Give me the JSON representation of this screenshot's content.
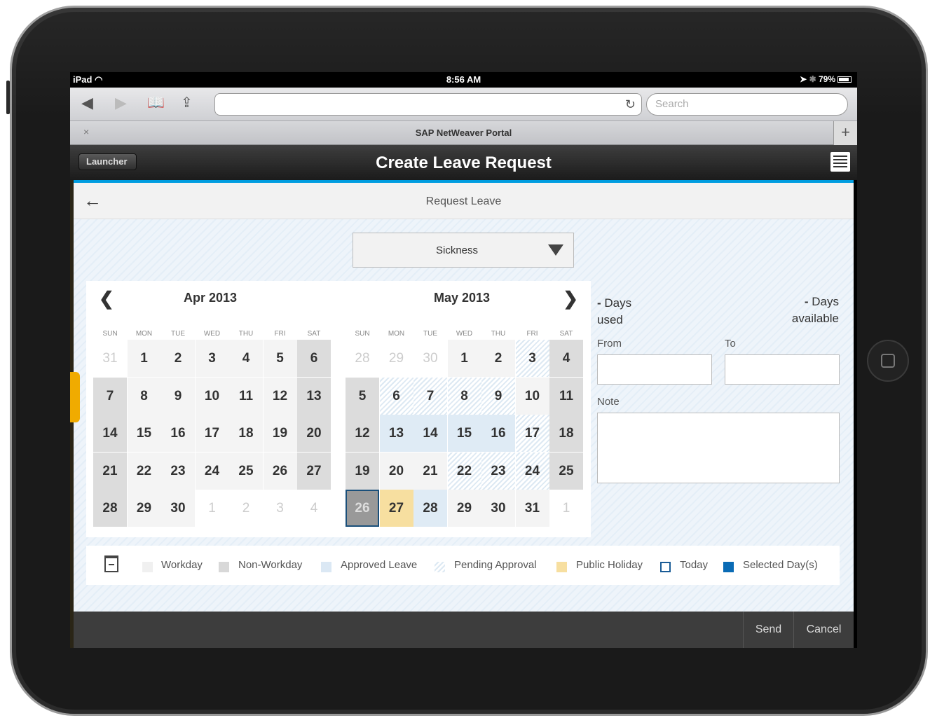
{
  "status_bar": {
    "device": "iPad",
    "time": "8:56 AM",
    "battery": "79%"
  },
  "browser": {
    "search_placeholder": "Search",
    "tab_title": "SAP NetWeaver Portal",
    "close_glyph": "×",
    "new_tab_glyph": "+"
  },
  "app_bar": {
    "back_label": "Launcher",
    "title": "Create Leave Request"
  },
  "page": {
    "subheader_title": "Request Leave"
  },
  "leave_type": {
    "selected": "Sickness"
  },
  "calendar": {
    "weekday_headers": [
      "SUN",
      "MON",
      "TUE",
      "WED",
      "THU",
      "FRI",
      "SAT"
    ],
    "months": [
      {
        "title": "Apr 2013",
        "weeks": [
          [
            {
              "d": "31",
              "s": "other"
            },
            {
              "d": "1",
              "s": "workday"
            },
            {
              "d": "2",
              "s": "workday"
            },
            {
              "d": "3",
              "s": "workday"
            },
            {
              "d": "4",
              "s": "workday"
            },
            {
              "d": "5",
              "s": "workday"
            },
            {
              "d": "6",
              "s": "nonwork"
            }
          ],
          [
            {
              "d": "7",
              "s": "nonwork"
            },
            {
              "d": "8",
              "s": "workday"
            },
            {
              "d": "9",
              "s": "workday"
            },
            {
              "d": "10",
              "s": "workday"
            },
            {
              "d": "11",
              "s": "workday"
            },
            {
              "d": "12",
              "s": "workday"
            },
            {
              "d": "13",
              "s": "nonwork"
            }
          ],
          [
            {
              "d": "14",
              "s": "nonwork"
            },
            {
              "d": "15",
              "s": "workday"
            },
            {
              "d": "16",
              "s": "workday"
            },
            {
              "d": "17",
              "s": "workday"
            },
            {
              "d": "18",
              "s": "workday"
            },
            {
              "d": "19",
              "s": "workday"
            },
            {
              "d": "20",
              "s": "nonwork"
            }
          ],
          [
            {
              "d": "21",
              "s": "nonwork"
            },
            {
              "d": "22",
              "s": "workday"
            },
            {
              "d": "23",
              "s": "workday"
            },
            {
              "d": "24",
              "s": "workday"
            },
            {
              "d": "25",
              "s": "workday"
            },
            {
              "d": "26",
              "s": "workday"
            },
            {
              "d": "27",
              "s": "nonwork"
            }
          ],
          [
            {
              "d": "28",
              "s": "nonwork"
            },
            {
              "d": "29",
              "s": "workday"
            },
            {
              "d": "30",
              "s": "workday"
            },
            {
              "d": "1",
              "s": "other"
            },
            {
              "d": "2",
              "s": "other"
            },
            {
              "d": "3",
              "s": "other"
            },
            {
              "d": "4",
              "s": "other"
            }
          ]
        ]
      },
      {
        "title": "May 2013",
        "weeks": [
          [
            {
              "d": "28",
              "s": "other"
            },
            {
              "d": "29",
              "s": "other"
            },
            {
              "d": "30",
              "s": "other"
            },
            {
              "d": "1",
              "s": "workday"
            },
            {
              "d": "2",
              "s": "workday"
            },
            {
              "d": "3",
              "s": "pending"
            },
            {
              "d": "4",
              "s": "nonwork"
            }
          ],
          [
            {
              "d": "5",
              "s": "nonwork"
            },
            {
              "d": "6",
              "s": "pending"
            },
            {
              "d": "7",
              "s": "pending"
            },
            {
              "d": "8",
              "s": "pending"
            },
            {
              "d": "9",
              "s": "pending"
            },
            {
              "d": "10",
              "s": "workday"
            },
            {
              "d": "11",
              "s": "nonwork"
            }
          ],
          [
            {
              "d": "12",
              "s": "nonwork"
            },
            {
              "d": "13",
              "s": "approved"
            },
            {
              "d": "14",
              "s": "approved"
            },
            {
              "d": "15",
              "s": "approved"
            },
            {
              "d": "16",
              "s": "approved"
            },
            {
              "d": "17",
              "s": "pending"
            },
            {
              "d": "18",
              "s": "nonwork"
            }
          ],
          [
            {
              "d": "19",
              "s": "nonwork"
            },
            {
              "d": "20",
              "s": "workday"
            },
            {
              "d": "21",
              "s": "workday"
            },
            {
              "d": "22",
              "s": "pending"
            },
            {
              "d": "23",
              "s": "pending"
            },
            {
              "d": "24",
              "s": "pending"
            },
            {
              "d": "25",
              "s": "nonwork"
            }
          ],
          [
            {
              "d": "26",
              "s": "today"
            },
            {
              "d": "27",
              "s": "holiday"
            },
            {
              "d": "28",
              "s": "approved"
            },
            {
              "d": "29",
              "s": "workday"
            },
            {
              "d": "30",
              "s": "workday"
            },
            {
              "d": "31",
              "s": "workday"
            },
            {
              "d": "1",
              "s": "other"
            }
          ]
        ]
      }
    ]
  },
  "summary": {
    "used_value": "-",
    "used_label_1": "Days",
    "used_label_2": "used",
    "available_value": "-",
    "available_label_1": "Days",
    "available_label_2": "available"
  },
  "form": {
    "from_label": "From",
    "to_label": "To",
    "note_label": "Note",
    "from_value": "",
    "to_value": "",
    "note_value": ""
  },
  "legend": [
    {
      "label": "Workday",
      "color": "#f0f0f0"
    },
    {
      "label": "Non-Workday",
      "color": "#d8d8d8"
    },
    {
      "label": "Approved Leave",
      "color": "#dbe8f4"
    },
    {
      "label": "Pending Approval",
      "color": "#e4eef7"
    },
    {
      "label": "Public Holiday",
      "color": "#f7dfa0"
    },
    {
      "label": "Today",
      "color": "#1a5c96"
    },
    {
      "label": "Selected Day(s)",
      "color": "#0a6bb5"
    }
  ],
  "footer": {
    "send_label": "Send",
    "cancel_label": "Cancel"
  },
  "icons": [
    "wifi-icon",
    "location-icon",
    "bluetooth-icon",
    "battery-icon",
    "back-icon",
    "forward-icon",
    "bookmarks-icon",
    "share-icon",
    "reload-icon",
    "menu-icon",
    "back-arrow-icon",
    "dropdown-arrow-icon",
    "prev-month-icon",
    "next-month-icon",
    "calendar-legend-icon",
    "home-button-icon"
  ]
}
